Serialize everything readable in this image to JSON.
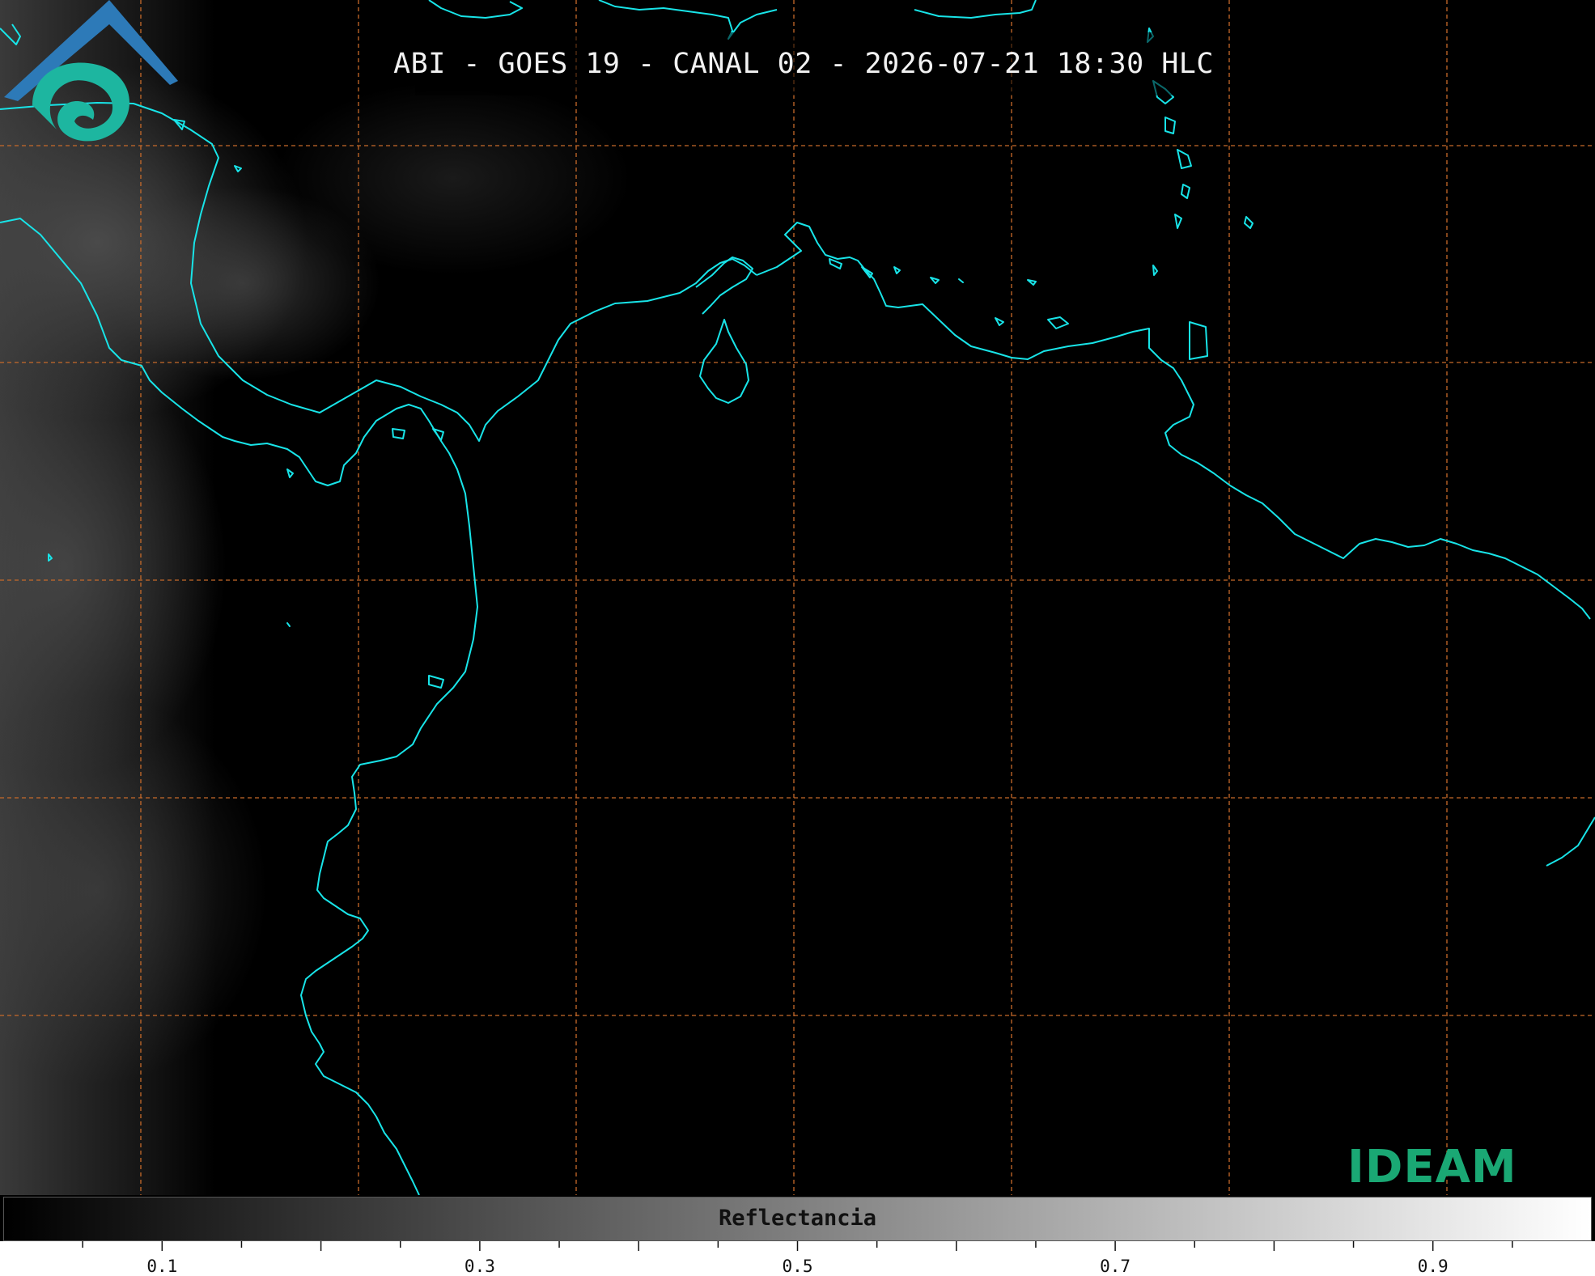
{
  "title": "ABI - GOES 19 - CANAL 02 - 2026-07-21 18:30 HLC",
  "colorbar": {
    "label": "Reflectancia",
    "min": 0,
    "max": 1,
    "ticks": [
      "0.1",
      "0.3",
      "0.5",
      "0.7",
      "0.9"
    ],
    "tick_values": [
      0.1,
      0.3,
      0.5,
      0.7,
      0.9
    ],
    "colormap": [
      "#000000",
      "#ffffff"
    ]
  },
  "logo": {
    "text": "IDEAM",
    "colors": {
      "text": "#1aa874",
      "roof": "#2d6fb3",
      "swirl": "#1db6a0"
    }
  },
  "map": {
    "coastline_color": "#18e4e8",
    "grid_color": "#c76a2a",
    "background": "#000000"
  }
}
